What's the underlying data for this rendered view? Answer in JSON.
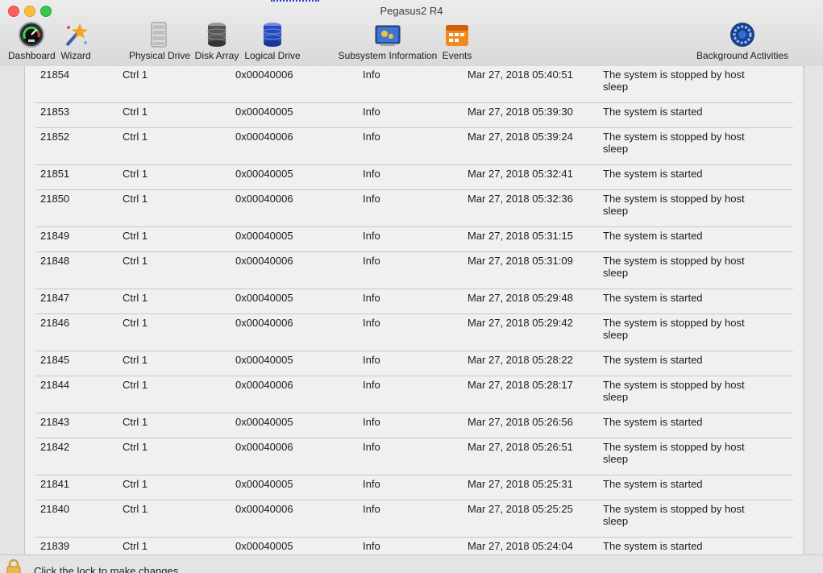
{
  "window": {
    "title": "Pegasus2 R4"
  },
  "toolbar": {
    "dashboard": "Dashboard",
    "wizard": "Wizard",
    "physical_drive": "Physical Drive",
    "disk_array": "Disk Array",
    "logical_drive": "Logical Drive",
    "subsystem_information": "Subsystem Information",
    "events": "Events",
    "background_activities": "Background Activities"
  },
  "events": [
    {
      "id": "21854",
      "device": "Ctrl 1",
      "code": "0x00040006",
      "severity": "Info",
      "time": "Mar 27, 2018 05:40:51",
      "description": "The system is stopped by host sleep"
    },
    {
      "id": "21853",
      "device": "Ctrl 1",
      "code": "0x00040005",
      "severity": "Info",
      "time": "Mar 27, 2018 05:39:30",
      "description": "The system is started"
    },
    {
      "id": "21852",
      "device": "Ctrl 1",
      "code": "0x00040006",
      "severity": "Info",
      "time": "Mar 27, 2018 05:39:24",
      "description": "The system is stopped by host sleep"
    },
    {
      "id": "21851",
      "device": "Ctrl 1",
      "code": "0x00040005",
      "severity": "Info",
      "time": "Mar 27, 2018 05:32:41",
      "description": "The system is started"
    },
    {
      "id": "21850",
      "device": "Ctrl 1",
      "code": "0x00040006",
      "severity": "Info",
      "time": "Mar 27, 2018 05:32:36",
      "description": "The system is stopped by host sleep"
    },
    {
      "id": "21849",
      "device": "Ctrl 1",
      "code": "0x00040005",
      "severity": "Info",
      "time": "Mar 27, 2018 05:31:15",
      "description": "The system is started"
    },
    {
      "id": "21848",
      "device": "Ctrl 1",
      "code": "0x00040006",
      "severity": "Info",
      "time": "Mar 27, 2018 05:31:09",
      "description": "The system is stopped by host sleep"
    },
    {
      "id": "21847",
      "device": "Ctrl 1",
      "code": "0x00040005",
      "severity": "Info",
      "time": "Mar 27, 2018 05:29:48",
      "description": "The system is started"
    },
    {
      "id": "21846",
      "device": "Ctrl 1",
      "code": "0x00040006",
      "severity": "Info",
      "time": "Mar 27, 2018 05:29:42",
      "description": "The system is stopped by host sleep"
    },
    {
      "id": "21845",
      "device": "Ctrl 1",
      "code": "0x00040005",
      "severity": "Info",
      "time": "Mar 27, 2018 05:28:22",
      "description": "The system is started"
    },
    {
      "id": "21844",
      "device": "Ctrl 1",
      "code": "0x00040006",
      "severity": "Info",
      "time": "Mar 27, 2018 05:28:17",
      "description": "The system is stopped by host sleep"
    },
    {
      "id": "21843",
      "device": "Ctrl 1",
      "code": "0x00040005",
      "severity": "Info",
      "time": "Mar 27, 2018 05:26:56",
      "description": "The system is started"
    },
    {
      "id": "21842",
      "device": "Ctrl 1",
      "code": "0x00040006",
      "severity": "Info",
      "time": "Mar 27, 2018 05:26:51",
      "description": "The system is stopped by host sleep"
    },
    {
      "id": "21841",
      "device": "Ctrl 1",
      "code": "0x00040005",
      "severity": "Info",
      "time": "Mar 27, 2018 05:25:31",
      "description": "The system is started"
    },
    {
      "id": "21840",
      "device": "Ctrl 1",
      "code": "0x00040006",
      "severity": "Info",
      "time": "Mar 27, 2018 05:25:25",
      "description": "The system is stopped by host sleep"
    },
    {
      "id": "21839",
      "device": "Ctrl 1",
      "code": "0x00040005",
      "severity": "Info",
      "time": "Mar 27, 2018 05:24:04",
      "description": "The system is started"
    }
  ],
  "footer": {
    "lock_text": "Click the lock to make changes."
  },
  "colors": {
    "close": "#fc615d",
    "minimize": "#fdbc40",
    "maximize": "#34c84a"
  }
}
